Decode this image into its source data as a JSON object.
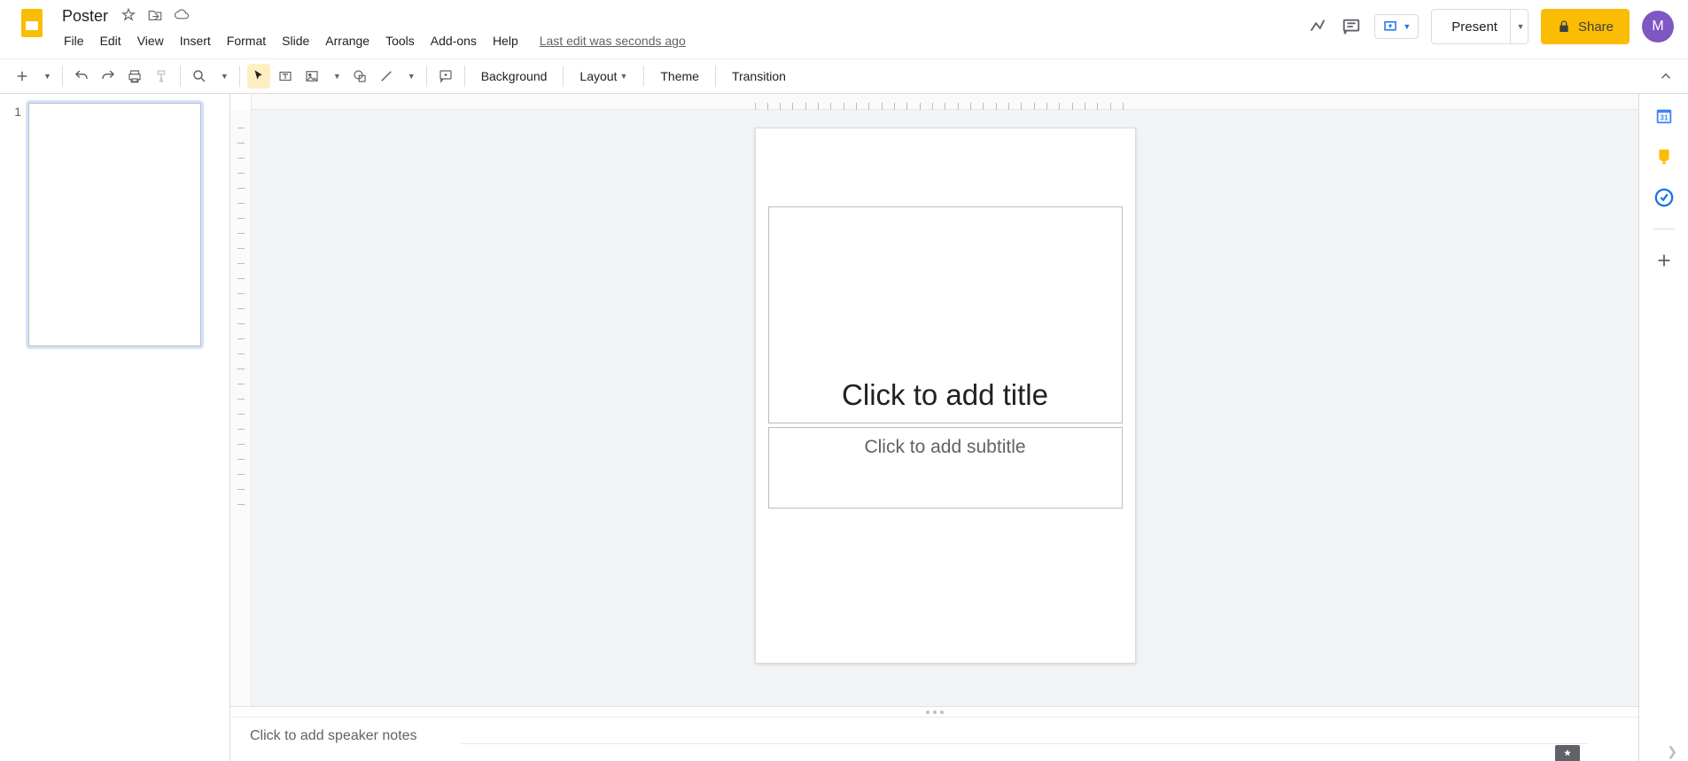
{
  "header": {
    "doc_title": "Poster",
    "last_edit": "Last edit was seconds ago",
    "present_label": "Present",
    "share_label": "Share",
    "avatar_initial": "M"
  },
  "menu": {
    "file": "File",
    "edit": "Edit",
    "view": "View",
    "insert": "Insert",
    "format": "Format",
    "slide": "Slide",
    "arrange": "Arrange",
    "tools": "Tools",
    "addons": "Add-ons",
    "help": "Help"
  },
  "toolbar": {
    "background": "Background",
    "layout": "Layout",
    "theme": "Theme",
    "transition": "Transition"
  },
  "filmstrip": {
    "slide1_num": "1"
  },
  "canvas": {
    "title_placeholder": "Click to add title",
    "subtitle_placeholder": "Click to add subtitle"
  },
  "notes": {
    "placeholder": "Click to add speaker notes"
  }
}
